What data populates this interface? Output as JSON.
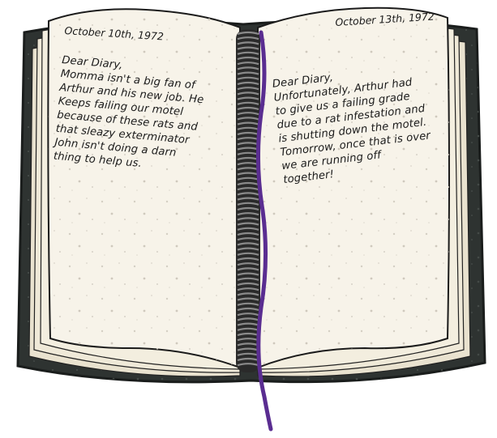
{
  "diary": {
    "left_page": {
      "date": "October 10th, 1972",
      "body": "Dear Diary,\nMomma isn't a big fan of\nArthur and his new job. He\nKeeps failing our motel\nbecause of these rats and\nthat sleazy exterminator\nJohn isn't doing a darn\nthing to help us."
    },
    "right_page": {
      "date": "October 13th, 1972",
      "body": "Dear Diary,\nUnfortunately, Arthur had\nto give us a failing grade\ndue to a rat infestation and\nis shutting down the motel.\nTomorrow, once that is over\nwe are running off\ntogether!"
    }
  },
  "colors": {
    "cover": "#2e3331",
    "page": "#f7f3e9",
    "page_edge": "#e9e2cf",
    "spiral": "#3a3a3a",
    "ribbon": "#5a2d91",
    "ink": "#1b1b1b"
  }
}
